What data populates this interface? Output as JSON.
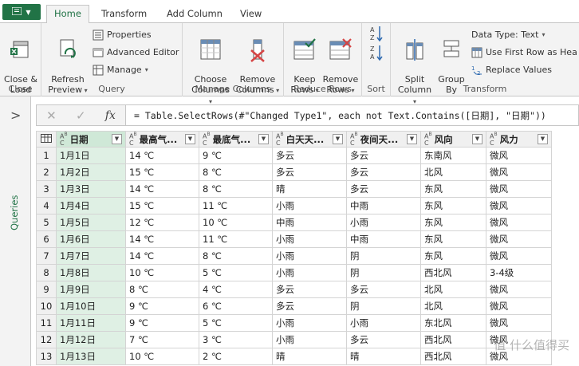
{
  "tabs": {
    "file_icon": "menu-icon",
    "items": [
      {
        "label": "Home",
        "active": true
      },
      {
        "label": "Transform",
        "active": false
      },
      {
        "label": "Add Column",
        "active": false
      },
      {
        "label": "View",
        "active": false
      }
    ]
  },
  "ribbon": {
    "close": {
      "button": "Close &\nLoad",
      "group": "Close"
    },
    "query": {
      "refresh": "Refresh\nPreview",
      "properties": "Properties",
      "advanced": "Advanced Editor",
      "manage": "Manage",
      "group": "Query"
    },
    "manage_columns": {
      "choose": "Choose\nColumns",
      "remove": "Remove\nColumns",
      "group": "Manage Columns"
    },
    "reduce_rows": {
      "keep": "Keep\nRows",
      "remove": "Remove\nRows",
      "group": "Reduce Rows"
    },
    "sort": {
      "group": "Sort"
    },
    "transform": {
      "split": "Split\nColumn",
      "group_by": "Group\nBy",
      "data_type": "Data Type: Text",
      "first_row": "Use First Row as Hea",
      "replace": "Replace Values",
      "group": "Transform"
    }
  },
  "sidepanel": {
    "label": "Queries"
  },
  "formula": {
    "fx": "fx",
    "text": "= Table.SelectRows(#\"Changed Type1\", each not Text.Contains([日期], \"日期\"))"
  },
  "grid": {
    "columns": [
      "日期",
      "最高气...",
      "最底气...",
      "白天天...",
      "夜间天...",
      "风向",
      "风力"
    ],
    "rows": [
      [
        "1",
        "1月1日",
        "14 ℃",
        "9 ℃",
        "多云",
        "多云",
        "东南风",
        "微风"
      ],
      [
        "2",
        "1月2日",
        "15 ℃",
        "8 ℃",
        "多云",
        "多云",
        "北风",
        "微风"
      ],
      [
        "3",
        "1月3日",
        "14 ℃",
        "8 ℃",
        "晴",
        "多云",
        "东风",
        "微风"
      ],
      [
        "4",
        "1月4日",
        "15 ℃",
        "11 ℃",
        "小雨",
        "中雨",
        "东风",
        "微风"
      ],
      [
        "5",
        "1月5日",
        "12 ℃",
        "10 ℃",
        "中雨",
        "小雨",
        "东风",
        "微风"
      ],
      [
        "6",
        "1月6日",
        "14 ℃",
        "11 ℃",
        "小雨",
        "中雨",
        "东风",
        "微风"
      ],
      [
        "7",
        "1月7日",
        "14 ℃",
        "8 ℃",
        "小雨",
        "阴",
        "东风",
        "微风"
      ],
      [
        "8",
        "1月8日",
        "10 ℃",
        "5 ℃",
        "小雨",
        "阴",
        "西北风",
        "3-4级"
      ],
      [
        "9",
        "1月9日",
        "8 ℃",
        "4 ℃",
        "多云",
        "多云",
        "北风",
        "微风"
      ],
      [
        "10",
        "1月10日",
        "9 ℃",
        "6 ℃",
        "多云",
        "阴",
        "北风",
        "微风"
      ],
      [
        "11",
        "1月11日",
        "9 ℃",
        "5 ℃",
        "小雨",
        "小雨",
        "东北风",
        "微风"
      ],
      [
        "12",
        "1月12日",
        "7 ℃",
        "3 ℃",
        "小雨",
        "多云",
        "西北风",
        "微风"
      ],
      [
        "13",
        "1月13日",
        "10 ℃",
        "2 ℃",
        "晴",
        "晴",
        "西北风",
        "微风"
      ]
    ]
  },
  "watermark": "值 什么值得买",
  "colors": {
    "accent": "#217346",
    "selected_column": "#dff0e4"
  }
}
